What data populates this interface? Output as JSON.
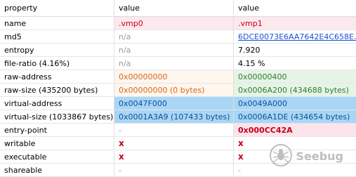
{
  "header": {
    "property": "property",
    "value1": "value",
    "value2": "value"
  },
  "rows": [
    {
      "property": "name",
      "v1": ".vmp0",
      "v2": ".vmp1"
    },
    {
      "property": "md5",
      "v1": "n/a",
      "v2": "6DCE0073E6AA7642E4C658E..."
    },
    {
      "property": "entropy",
      "v1": "n/a",
      "v2": "7.920"
    },
    {
      "property": "file-ratio (4.16%)",
      "v1": "n/a",
      "v2": "4.15 %"
    },
    {
      "property": "raw-address",
      "v1": "0x00000000",
      "v2": "0x00000400"
    },
    {
      "property": "raw-size (435200 bytes)",
      "v1": "0x00000000 (0 bytes)",
      "v2": "0x0006A200 (434688 bytes)"
    },
    {
      "property": "virtual-address",
      "v1": "0x0047F000",
      "v2": "0x0049A000"
    },
    {
      "property": "virtual-size (1033867 bytes)",
      "v1": "0x0001A3A9 (107433 bytes)",
      "v2": "0x0006A1DE (434654 bytes)"
    },
    {
      "property": "entry-point",
      "v1": "-",
      "v2": "0x000CC42A"
    },
    {
      "property": "writable",
      "v1": "x",
      "v2": "x"
    },
    {
      "property": "executable",
      "v1": "x",
      "v2": "x"
    },
    {
      "property": "shareable",
      "v1": "-",
      "v2": "-"
    }
  ],
  "watermark": {
    "text": "Seebug",
    "icon": "spider-logo-icon"
  }
}
